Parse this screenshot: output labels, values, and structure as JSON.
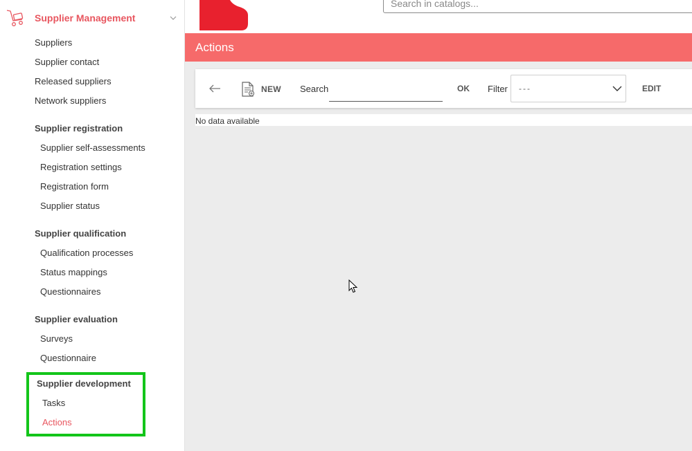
{
  "sidebar": {
    "module_title": "Supplier Management",
    "top_items": [
      "Suppliers",
      "Supplier contact",
      "Released suppliers",
      "Network suppliers"
    ],
    "groups": [
      {
        "title": "Supplier registration",
        "items": [
          "Supplier self-assessments",
          "Registration settings",
          "Registration form",
          "Supplier status"
        ]
      },
      {
        "title": "Supplier qualification",
        "items": [
          "Qualification processes",
          "Status mappings",
          "Questionnaires"
        ]
      },
      {
        "title": "Supplier evaluation",
        "items": [
          "Surveys",
          "Questionnaire"
        ]
      },
      {
        "title": "Supplier development",
        "items": [
          "Tasks",
          "Actions"
        ]
      }
    ],
    "active_item": "Actions"
  },
  "header": {
    "catalog_search_placeholder": "Search in catalogs..."
  },
  "page": {
    "title": "Actions"
  },
  "toolbar": {
    "new_label": "NEW",
    "search_label": "Search",
    "search_value": "",
    "ok_label": "OK",
    "filter_label": "Filter",
    "filter_value": "---",
    "edit_label": "EDIT"
  },
  "table": {
    "empty_message": "No data available"
  },
  "colors": {
    "accent": "#e8565f",
    "title_bar": "#f66a6a",
    "logo": "#e8212e",
    "highlight": "#13c51a",
    "content_bg": "#ececec"
  },
  "icons": {
    "module": "cart-icon",
    "module_toggle": "chevron-down-icon",
    "back": "arrow-left-icon",
    "new": "new-document-icon",
    "filter_toggle": "chevron-down-icon"
  }
}
